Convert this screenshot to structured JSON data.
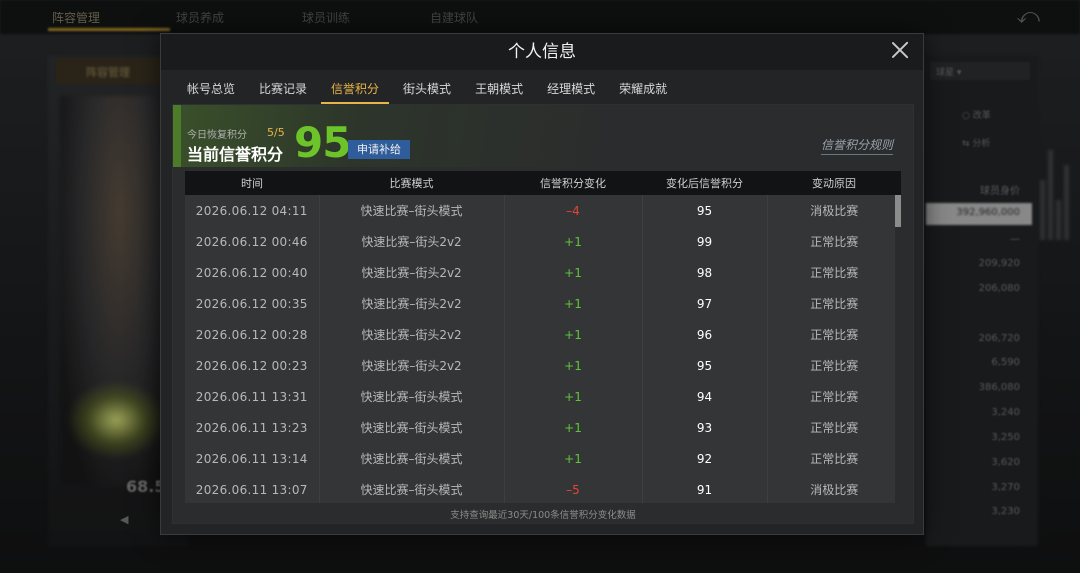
{
  "background": {
    "nav_items": [
      "阵容管理",
      "球员养成",
      "球员训练",
      "自建球队"
    ],
    "left_tab": "阵容管理",
    "player_rating": "68.5",
    "dropdown_value": "球星",
    "right_buttons": [
      "改革",
      "分析"
    ],
    "right_header": "球员身价",
    "highlight_value": "392,960,000",
    "right_values": [
      "—",
      "209,920",
      "206,080",
      "206,720",
      "6,590",
      "386,080",
      "3,240",
      "3,250",
      "3,620",
      "3,270",
      "3,230"
    ]
  },
  "modal": {
    "title": "个人信息",
    "tabs": [
      {
        "label": "帐号总览",
        "active": false
      },
      {
        "label": "比赛记录",
        "active": false
      },
      {
        "label": "信誉积分",
        "active": true
      },
      {
        "label": "街头模式",
        "active": false
      },
      {
        "label": "王朝模式",
        "active": false
      },
      {
        "label": "经理模式",
        "active": false
      },
      {
        "label": "荣耀成就",
        "active": false
      }
    ]
  },
  "credit": {
    "today_label": "今日恢复积分",
    "today_count": "5/5",
    "current_label": "当前信誉积分",
    "current_score": "95",
    "apply_button": "申请补给",
    "rules_link": "信誉积分规则"
  },
  "table": {
    "headers": [
      "时间",
      "比赛模式",
      "信誉积分变化",
      "变化后信誉积分",
      "变动原因"
    ],
    "rows": [
      {
        "time": "2026.06.12  04:11",
        "mode": "快速比赛–街头模式",
        "change": "–4",
        "change_type": "neg",
        "after": "95",
        "reason": "消极比赛"
      },
      {
        "time": "2026.06.12  00:46",
        "mode": "快速比赛–街头2v2",
        "change": "+1",
        "change_type": "pos",
        "after": "99",
        "reason": "正常比赛"
      },
      {
        "time": "2026.06.12  00:40",
        "mode": "快速比赛–街头2v2",
        "change": "+1",
        "change_type": "pos",
        "after": "98",
        "reason": "正常比赛"
      },
      {
        "time": "2026.06.12  00:35",
        "mode": "快速比赛–街头2v2",
        "change": "+1",
        "change_type": "pos",
        "after": "97",
        "reason": "正常比赛"
      },
      {
        "time": "2026.06.12  00:28",
        "mode": "快速比赛–街头2v2",
        "change": "+1",
        "change_type": "pos",
        "after": "96",
        "reason": "正常比赛"
      },
      {
        "time": "2026.06.12  00:23",
        "mode": "快速比赛–街头2v2",
        "change": "+1",
        "change_type": "pos",
        "after": "95",
        "reason": "正常比赛"
      },
      {
        "time": "2026.06.11  13:31",
        "mode": "快速比赛–街头模式",
        "change": "+1",
        "change_type": "pos",
        "after": "94",
        "reason": "正常比赛"
      },
      {
        "time": "2026.06.11  13:23",
        "mode": "快速比赛–街头模式",
        "change": "+1",
        "change_type": "pos",
        "after": "93",
        "reason": "正常比赛"
      },
      {
        "time": "2026.06.11  13:14",
        "mode": "快速比赛–街头模式",
        "change": "+1",
        "change_type": "pos",
        "after": "92",
        "reason": "正常比赛"
      },
      {
        "time": "2026.06.11  13:07",
        "mode": "快速比赛–街头模式",
        "change": "–5",
        "change_type": "neg",
        "after": "91",
        "reason": "消极比赛"
      }
    ],
    "footer_note": "支持查询最近30天/100条信誉积分变化数据"
  },
  "colors": {
    "accent_gold": "#e8b54a",
    "score_green": "#6cc42a",
    "positive": "#5ec43a",
    "negative": "#e64338",
    "button_blue": "#2f5c9a"
  },
  "icons": {
    "close": "close-icon",
    "back": "back-arrow-icon"
  }
}
